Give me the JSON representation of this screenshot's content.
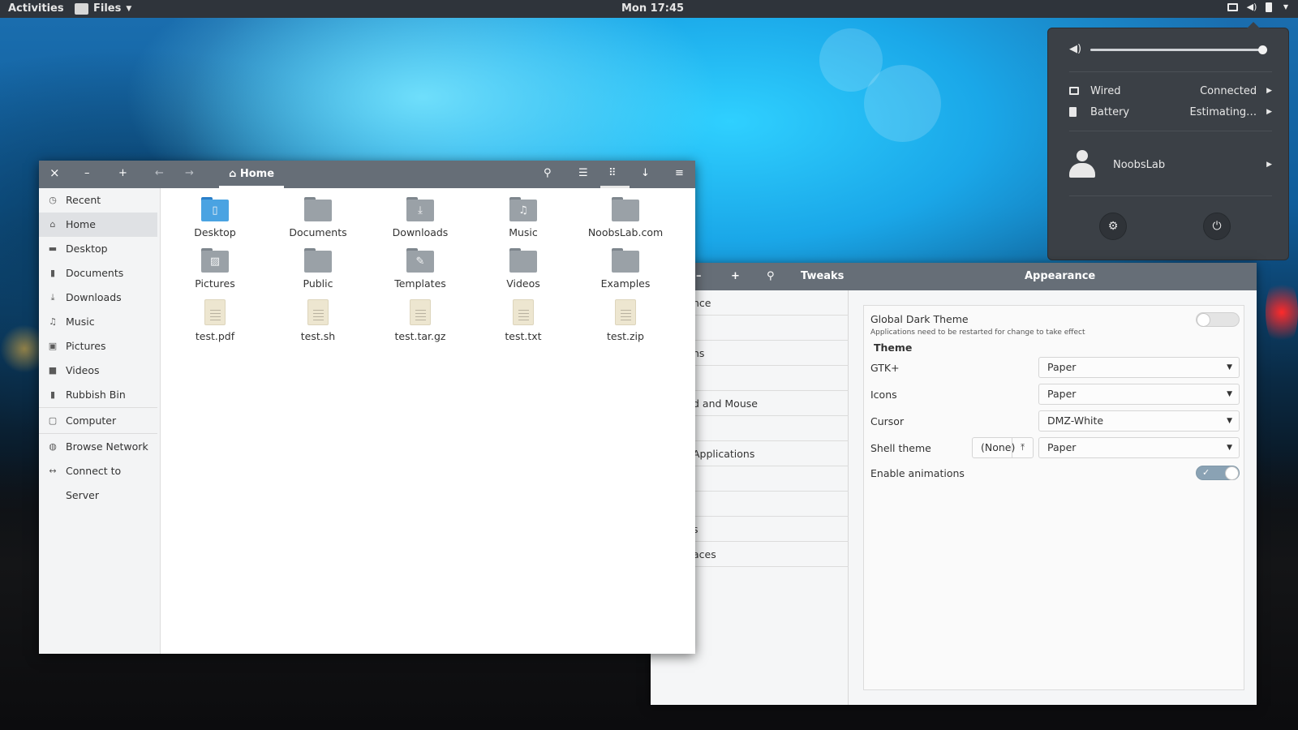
{
  "topbar": {
    "activities": "Activities",
    "app_menu": "Files",
    "clock": "Mon 17:45",
    "tray_icons": [
      "display-icon",
      "volume-icon",
      "battery-icon",
      "menu-arrow-icon"
    ]
  },
  "system_menu": {
    "volume_level": 0.98,
    "wired": {
      "label": "Wired",
      "status": "Connected"
    },
    "battery": {
      "label": "Battery",
      "status": "Estimating…"
    },
    "user": {
      "name": "NoobsLab"
    },
    "buttons": [
      "settings-icon",
      "power-icon"
    ]
  },
  "files": {
    "header": {
      "close": "×",
      "minimize": "–",
      "maximize": "+",
      "path": "Home"
    },
    "sidebar": [
      {
        "label": "Recent",
        "icon": "◷"
      },
      {
        "label": "Home",
        "icon": "⌂",
        "active": true
      },
      {
        "label": "Desktop",
        "icon": "▬"
      },
      {
        "label": "Documents",
        "icon": "▮"
      },
      {
        "label": "Downloads",
        "icon": "⤓"
      },
      {
        "label": "Music",
        "icon": "♫"
      },
      {
        "label": "Pictures",
        "icon": "▣"
      },
      {
        "label": "Videos",
        "icon": "■"
      },
      {
        "label": "Rubbish Bin",
        "icon": "▮"
      },
      {
        "label": "Computer",
        "icon": "▢"
      },
      {
        "label": "Browse Network",
        "icon": "◍"
      },
      {
        "label": "Connect to Server",
        "icon": "↔"
      }
    ],
    "items": [
      {
        "name": "Desktop",
        "kind": "folder-desktop",
        "glyph": "▯"
      },
      {
        "name": "Documents",
        "kind": "folder",
        "glyph": ""
      },
      {
        "name": "Downloads",
        "kind": "folder",
        "glyph": "⤓"
      },
      {
        "name": "Music",
        "kind": "folder",
        "glyph": "♫"
      },
      {
        "name": "NoobsLab.com",
        "kind": "folder",
        "glyph": ""
      },
      {
        "name": "Pictures",
        "kind": "folder",
        "glyph": "▨"
      },
      {
        "name": "Public",
        "kind": "folder",
        "glyph": ""
      },
      {
        "name": "Templates",
        "kind": "folder",
        "glyph": "✎"
      },
      {
        "name": "Videos",
        "kind": "folder",
        "glyph": ""
      },
      {
        "name": "Examples",
        "kind": "folder",
        "glyph": ""
      },
      {
        "name": "test.pdf",
        "kind": "file"
      },
      {
        "name": "test.sh",
        "kind": "file"
      },
      {
        "name": "test.tar.gz",
        "kind": "file"
      },
      {
        "name": "test.txt",
        "kind": "file"
      },
      {
        "name": "test.zip",
        "kind": "file"
      }
    ]
  },
  "tweaks": {
    "header": {
      "minimize": "–",
      "maximize": "+",
      "title": "Tweaks",
      "section": "Appearance"
    },
    "sidebar": [
      "nce",
      "",
      "ns",
      "",
      "d and Mouse",
      "",
      "Applications",
      "",
      "",
      "s",
      "aces"
    ],
    "global_dark": {
      "label": "Global Dark Theme",
      "note": "Applications need to be restarted for change to take effect",
      "enabled": false
    },
    "theme_heading": "Theme",
    "gtk": {
      "label": "GTK+",
      "value": "Paper"
    },
    "icons": {
      "label": "Icons",
      "value": "Paper"
    },
    "cursor": {
      "label": "Cursor",
      "value": "DMZ-White"
    },
    "shell": {
      "label": "Shell theme",
      "none_label": "(None)",
      "value": "Paper"
    },
    "animations": {
      "label": "Enable animations",
      "enabled": true
    }
  }
}
